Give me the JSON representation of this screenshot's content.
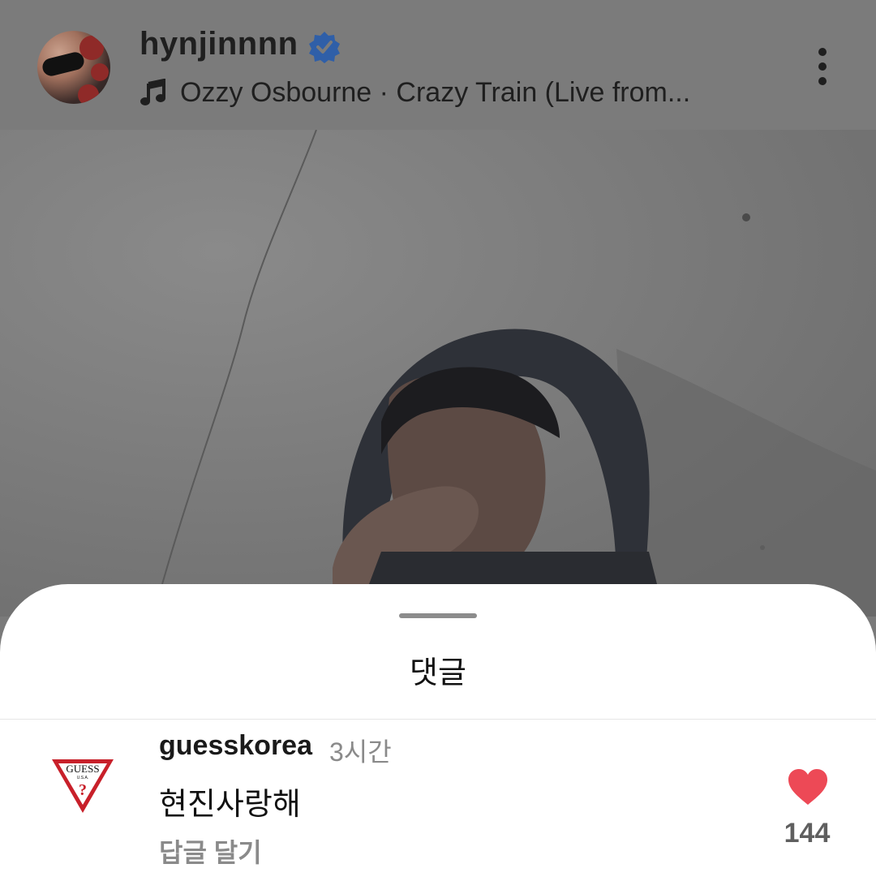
{
  "header": {
    "username": "hynjinnnn",
    "verified_icon": "verified-badge-icon",
    "music_icon": "music-note-icon",
    "music_text": "Ozzy Osbourne · Crazy Train (Live from...",
    "more_icon": "more-vertical-icon"
  },
  "sheet": {
    "title": "댓글",
    "comments": [
      {
        "avatar_logo": "GUESS",
        "avatar_logo_sub": "U.S.A.",
        "username": "guesskorea",
        "time": "3시간",
        "text": "현진사랑해",
        "reply_label": "답글 달기",
        "like_icon": "heart-icon",
        "like_count": "144",
        "like_color": "#ed4956"
      }
    ]
  },
  "colors": {
    "dim_overlay": "#7b7b7b",
    "verified_blue": "#2f5fa8"
  }
}
